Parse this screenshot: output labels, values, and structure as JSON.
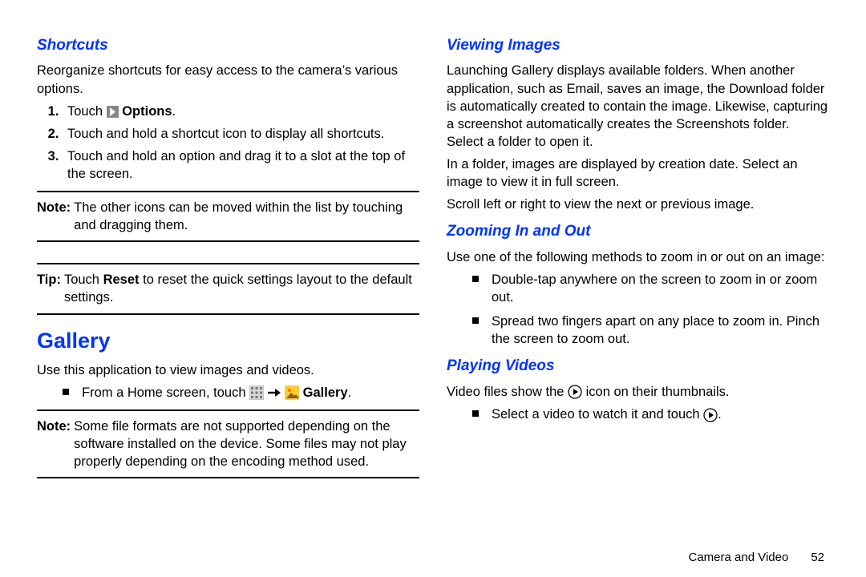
{
  "left": {
    "shortcuts": {
      "title": "Shortcuts",
      "intro": "Reorganize shortcuts for easy access to the camera’s various options.",
      "step1_pre": "Touch ",
      "step1_bold": "Options",
      "step1_post": ".",
      "step2": "Touch and hold a shortcut icon to display all shortcuts.",
      "step3": "Touch and hold an option and drag it to a slot at the top of the screen.",
      "note_label": "Note:",
      "note_body": "The other icons can be moved within the list by touching and dragging them.",
      "tip_label": "Tip:",
      "tip_pre": "Touch ",
      "tip_bold": "Reset",
      "tip_post": " to reset the quick settings layout to the default settings."
    },
    "gallery": {
      "title": "Gallery",
      "intro": "Use this application to view images and videos.",
      "b1_pre": "From a Home screen, touch ",
      "b1_bold": "Gallery",
      "b1_post": ".",
      "note_label": "Note:",
      "note_body": "Some file formats are not supported depending on the software installed on the device. Some files may not play properly depending on the encoding method used."
    }
  },
  "right": {
    "viewing": {
      "title": "Viewing Images",
      "p1": "Launching Gallery displays available folders. When another application, such as Email, saves an image, the Download folder is automatically created to contain the image. Likewise, capturing a screenshot automatically creates the Screenshots folder. Select a folder to open it.",
      "p2": "In a folder, images are displayed by creation date. Select an image to view it in full screen.",
      "p3": "Scroll left or right to view the next or previous image."
    },
    "zoom": {
      "title": "Zooming In and Out",
      "intro": "Use one of the following methods to zoom in or out on an image:",
      "b1": "Double-tap anywhere on the screen to zoom in or zoom out.",
      "b2": "Spread two fingers apart on any place to zoom in. Pinch the screen to zoom out."
    },
    "play": {
      "title": "Playing Videos",
      "intro_pre": "Video files show the ",
      "intro_post": " icon on their thumbnails.",
      "b1_pre": "Select a video to watch it and touch ",
      "b1_post": "."
    }
  },
  "footer": {
    "section": "Camera and Video",
    "page": "52"
  }
}
